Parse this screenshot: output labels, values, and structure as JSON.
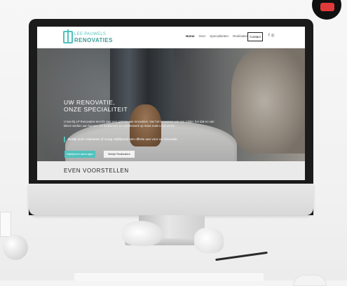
{
  "site": {
    "logo": {
      "top": "LEE PAUWELS",
      "bottom": "RENOVATIES"
    },
    "nav": [
      "Home",
      "Over",
      "Specialiteiten",
      "Realisaties"
    ],
    "contact_label": "Contact",
    "nav_icons_text": "f ◎",
    "hero": {
      "title_line1": "UW RENOVATIE,",
      "title_line2": "ONZE SPECIALITEIT",
      "lead": "U kan bij LP Renovaties terecht voor een gamma aan renovaties. Van het renoveren van een zolder, het dak en van kleine werken aan kamers, tot badkamers en schilderwerk op maat zoals u het wenst.",
      "callout": "Bekijk onze realisaties of vraag vrijblijvend een offerte aan voor uw renovatie.",
      "primary_button": "Vrijblijvend aanvragen",
      "secondary_button": "Bekijk Realisaties"
    },
    "section_title": "EVEN VOORSTELLEN"
  },
  "icons": {
    "apple_glyph": "",
    "colors": {
      "accent": "#4fc2bd",
      "dark_text": "#222222",
      "screen_bg": "#ffffff"
    }
  }
}
